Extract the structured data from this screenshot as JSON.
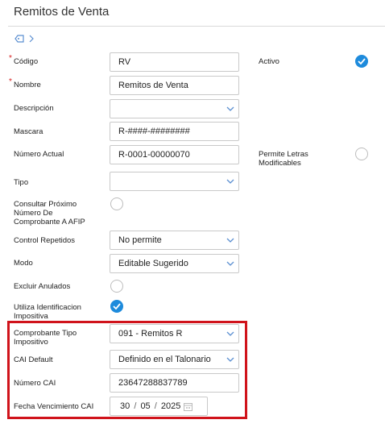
{
  "header": {
    "title": "Remitos de Venta"
  },
  "form": {
    "codigo": {
      "label": "Código",
      "value": "RV"
    },
    "nombre": {
      "label": "Nombre",
      "value": "Remitos de Venta"
    },
    "descripcion": {
      "label": "Descripción",
      "value": ""
    },
    "mascara": {
      "label": "Mascara",
      "value": "R-####-########"
    },
    "numero_actual": {
      "label": "Número Actual",
      "value": "R-0001-00000070"
    },
    "tipo": {
      "label": "Tipo",
      "value": ""
    },
    "consultar": {
      "label_1": "Consultar Próximo",
      "label_2": "Número De",
      "label_3": "Comprobante A AFIP",
      "checked": false
    },
    "control_repetidos": {
      "label": "Control Repetidos",
      "value": "No permite"
    },
    "modo": {
      "label": "Modo",
      "value": "Editable Sugerido"
    },
    "excluir_anulados": {
      "label": "Excluir Anulados",
      "checked": false
    },
    "utiliza_identificacion": {
      "label_1": "Utiliza Identificacion",
      "label_2": "Impositiva",
      "checked": true
    },
    "comprobante_tipo": {
      "label_1": "Comprobante Tipo",
      "label_2": "Impositivo",
      "value": "091 - Remitos R"
    },
    "cai_default": {
      "label": "CAI Default",
      "value": "Definido en el Talonario"
    },
    "numero_cai": {
      "label": "Número CAI",
      "value": "23647288837789"
    },
    "fecha_vencimiento": {
      "label": "Fecha Vencimiento CAI",
      "day": "30",
      "month": "05",
      "year": "2025",
      "sep": "/"
    }
  },
  "right": {
    "activo": {
      "label": "Activo",
      "checked": true
    },
    "permite_letras": {
      "label_1": "Permite Letras",
      "label_2": "Modificables",
      "checked": false
    }
  },
  "colors": {
    "accent": "#1e8bdc",
    "highlight": "#d0131b",
    "required": "#d62020"
  }
}
